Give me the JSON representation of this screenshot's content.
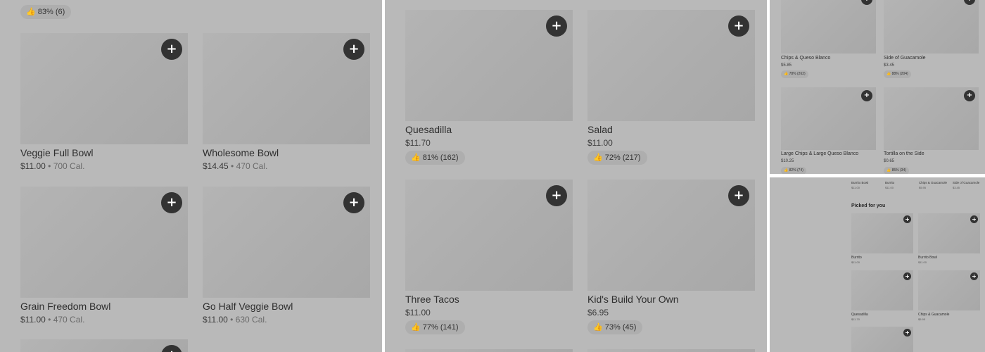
{
  "panel1": {
    "top_rating": "83% (6)",
    "items": [
      {
        "name": "Veggie Full Bowl",
        "price": "$11.00",
        "calories": "700 Cal."
      },
      {
        "name": "Wholesome Bowl",
        "price": "$14.45",
        "calories": "470 Cal."
      },
      {
        "name": "Grain Freedom Bowl",
        "price": "$11.00",
        "calories": "470 Cal."
      },
      {
        "name": "Go Half Veggie Bowl",
        "price": "$11.00",
        "calories": "630 Cal."
      }
    ],
    "separator": "•",
    "add_label": "+"
  },
  "panel2": {
    "items": [
      {
        "name": "Quesadilla",
        "price": "$11.70",
        "rating": "81% (162)"
      },
      {
        "name": "Salad",
        "price": "$11.00",
        "rating": "72% (217)"
      },
      {
        "name": "Three Tacos",
        "price": "$11.00",
        "rating": "77% (141)"
      },
      {
        "name": "Kid's Build Your Own",
        "price": "$6.95",
        "rating": "73% (45)"
      }
    ]
  },
  "panel3": {
    "items": [
      {
        "name": "Chips & Queso Blanco",
        "price": "$5.85",
        "rating": "78% (262)"
      },
      {
        "name": "Side of Guacamole",
        "price": "$3.45",
        "rating": "88% (204)"
      },
      {
        "name": "Large Chips & Large Queso Blanco",
        "price": "$10.25",
        "rating": "82% (74)"
      },
      {
        "name": "Tortilla on the Side",
        "price": "$0.65",
        "rating": "85% (34)"
      }
    ]
  },
  "panel4": {
    "top_row": [
      {
        "name": "Burrito Bowl",
        "price": "$11.00"
      },
      {
        "name": "Burrito",
        "price": "$11.00"
      },
      {
        "name": "Chips & Guacamole",
        "price": "$5.95"
      },
      {
        "name": "Side of Guacamole",
        "price": "$3.45"
      }
    ],
    "section_title": "Picked for you",
    "items": [
      {
        "name": "Burrito",
        "price": "$11.00"
      },
      {
        "name": "Burrito Bowl",
        "price": "$11.00"
      },
      {
        "name": "Quesadilla",
        "price": "$11.70"
      },
      {
        "name": "Chips & Guacamole",
        "price": "$5.95"
      }
    ]
  },
  "icons": {
    "thumb": "👍",
    "plus": "+"
  },
  "colors": {
    "overlay_gray": "#b9b9b9",
    "add_button": "#333333",
    "rating_pill": "#aeaeae"
  }
}
